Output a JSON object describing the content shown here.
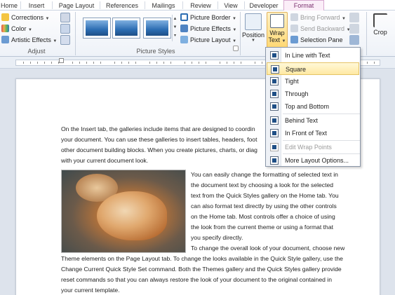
{
  "tabs": {
    "home": "Home",
    "insert": "Insert",
    "page_layout": "Page Layout",
    "references": "References",
    "mailings": "Mailings",
    "review": "Review",
    "view": "View",
    "developer": "Developer",
    "format": "Format"
  },
  "ribbon": {
    "adjust": {
      "corrections": "Corrections",
      "color": "Color",
      "artistic_effects": "Artistic Effects",
      "label": "Adjust"
    },
    "picture_styles": {
      "picture_border": "Picture Border",
      "picture_effects": "Picture Effects",
      "picture_layout": "Picture Layout",
      "label": "Picture Styles"
    },
    "arrange": {
      "position": "Position",
      "wrap_text_1": "Wrap",
      "wrap_text_2": "Text",
      "bring_forward": "Bring Forward",
      "send_backward": "Send Backward",
      "selection_pane": "Selection Pane"
    },
    "size": {
      "crop": "Crop"
    }
  },
  "wrap_menu": {
    "items": [
      {
        "label": "In Line with Text",
        "icon": "inline-wrap-icon"
      },
      {
        "label": "Square",
        "icon": "square-wrap-icon"
      },
      {
        "label": "Tight",
        "icon": "tight-wrap-icon"
      },
      {
        "label": "Through",
        "icon": "through-wrap-icon"
      },
      {
        "label": "Top and Bottom",
        "icon": "top-bottom-wrap-icon"
      },
      {
        "label": "Behind Text",
        "icon": "behind-text-icon"
      },
      {
        "label": "In Front of Text",
        "icon": "in-front-text-icon"
      },
      {
        "label": "Edit Wrap Points",
        "icon": "edit-wrap-points-icon"
      },
      {
        "label": "More Layout Options...",
        "icon": "layout-options-icon"
      }
    ],
    "highlighted": "Square"
  },
  "document": {
    "para1": [
      "On the Insert tab, the galleries include items that are designed to coordin",
      "your document. You can use these galleries to insert tables, headers, foot",
      "other document building blocks. When you create pictures, charts, or diag",
      "with your current document look."
    ],
    "para2": [
      "You can easily change the formatting of selected text in",
      "the document text by choosing a look for the selected",
      "text from the Quick Styles gallery on the Home tab. You",
      "can also format text directly by using the other controls",
      "on the Home tab. Most controls offer a choice of using",
      "the look from the current theme or using a format that",
      "you specify directly."
    ],
    "para3": [
      "To change the overall look of your document, choose new",
      "Theme elements on the Page Layout tab. To change the looks available in the Quick Style gallery, use the",
      "Change Current Quick Style Set command. Both the Themes gallery and the Quick Styles gallery provide",
      "reset commands so that you can always  restore the look of your document to the original contained in",
      "your current template."
    ]
  },
  "colors": {
    "accent": "#1f4f86",
    "menu_highlight": "#ffe9a3",
    "context_tab": "#fbeef8"
  }
}
